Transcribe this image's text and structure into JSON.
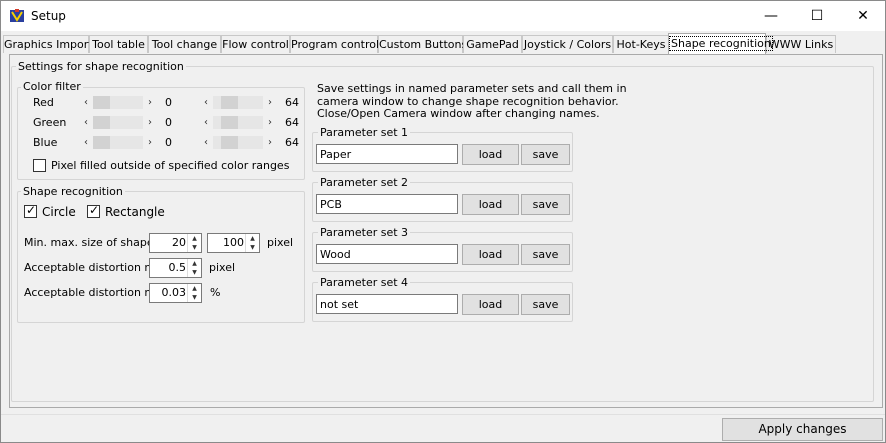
{
  "window": {
    "title": "Setup",
    "minimize": "—",
    "maximize": "☐",
    "close": "✕"
  },
  "tabs": [
    "Graphics Import",
    "Tool table",
    "Tool change",
    "Flow control",
    "Program control",
    "Custom Buttons",
    "GamePad",
    "Joystick / Colors",
    "Hot-Keys",
    "Shape recognition",
    "WWW Links"
  ],
  "active_tab": "Shape recognition",
  "settings_group": {
    "label": "Settings for shape recognition"
  },
  "color_filter": {
    "label": "Color filter",
    "rows": [
      {
        "name": "Red",
        "min": "0",
        "max": "64",
        "min_fraction": 0,
        "max_fraction": 0.25
      },
      {
        "name": "Green",
        "min": "0",
        "max": "64",
        "min_fraction": 0,
        "max_fraction": 0.25
      },
      {
        "name": "Blue",
        "min": "0",
        "max": "64",
        "min_fraction": 0,
        "max_fraction": 0.25
      }
    ],
    "outside_checkbox": {
      "label": "Pixel filled outside of specified color ranges",
      "checked": false
    }
  },
  "shape_recognition": {
    "label": "Shape recognition",
    "circle": {
      "label": "Circle",
      "checked": true
    },
    "rectangle": {
      "label": "Rectangle",
      "checked": true
    },
    "size_label": "Min. max. size of shape",
    "size_min": "20",
    "size_max": "100",
    "size_unit": "pixel",
    "dist_min_label": "Acceptable distortion min.",
    "dist_min": "0.5",
    "dist_min_unit": "pixel",
    "dist_max_label": "Acceptable distortion max.",
    "dist_max": "0.03",
    "dist_max_unit": "%"
  },
  "info_text": [
    "Save settings in named parameter sets and call them in",
    "camera window to change shape recognition behavior.",
    "Close/Open Camera window after changing names."
  ],
  "parameter_sets": [
    {
      "label": "Parameter set 1",
      "value": "Paper",
      "load": "load",
      "save": "save"
    },
    {
      "label": "Parameter set 2",
      "value": "PCB",
      "load": "load",
      "save": "save"
    },
    {
      "label": "Parameter set 3",
      "value": "Wood",
      "load": "load",
      "save": "save"
    },
    {
      "label": "Parameter set 4",
      "value": "not set",
      "load": "load",
      "save": "save"
    }
  ],
  "apply_button": "Apply changes",
  "icons": {
    "app": "cnc-app-icon",
    "arrow_left": "‹",
    "arrow_right": "›",
    "spin_up": "▲",
    "spin_down": "▼",
    "check": "✓"
  }
}
